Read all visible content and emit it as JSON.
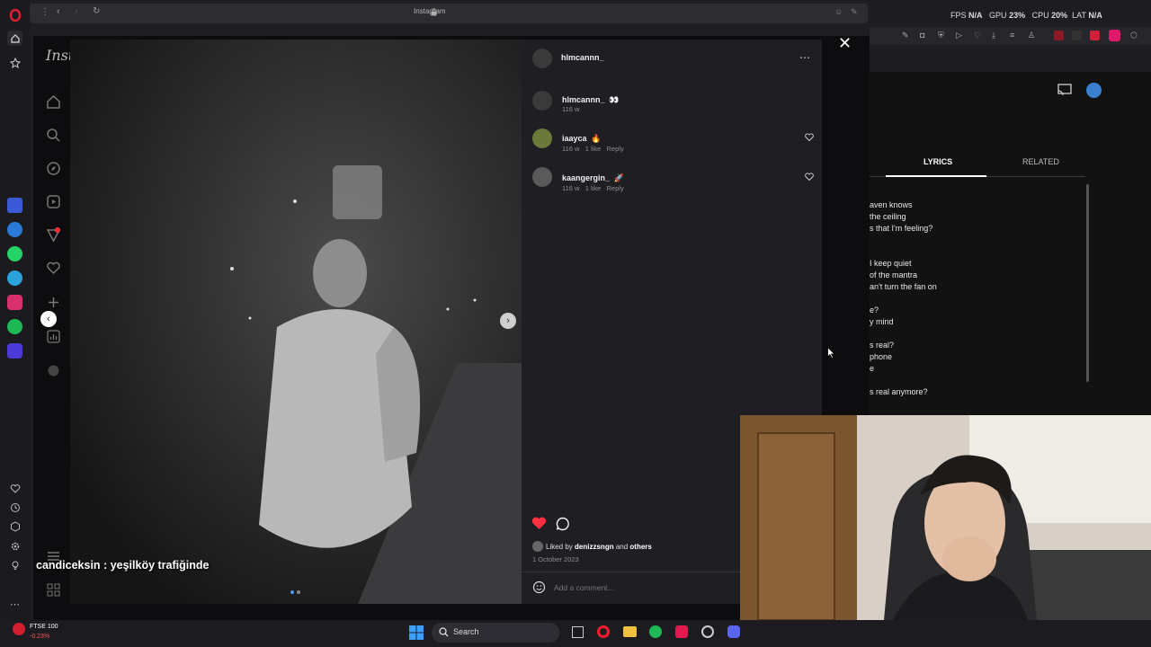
{
  "browser": {
    "url": "Instagram"
  },
  "overlay": {
    "fps_label": "FPS",
    "fps_value": "N/A",
    "gpu_label": "GPU",
    "gpu_value": "23%",
    "cpu_label": "CPU",
    "cpu_value": "20%",
    "lat_label": "LAT",
    "lat_value": "N/A"
  },
  "instagram": {
    "logo": "Inst",
    "post": {
      "author": "hlmcannn_",
      "caption_author": "hlmcannn_",
      "caption_emoji": "👀",
      "caption_time": "116 w",
      "comments": [
        {
          "user": "iaayca",
          "emoji": "🔥",
          "time": "116 w",
          "likes": "1 like",
          "reply": "Reply"
        },
        {
          "user": "kaangergin_",
          "emoji": "🚀",
          "time": "116 w",
          "likes": "1 like",
          "reply": "Reply"
        }
      ],
      "liked_by_prefix": "Liked by",
      "liked_by_user": "denizzsngn",
      "liked_by_and": "and",
      "liked_by_others": "others",
      "date": "1 October 2023",
      "comment_placeholder": "Add a comment...",
      "liked": true
    }
  },
  "chat_overlay": {
    "user": "candiceksin",
    "message": ": yeşilköy trafiğinde"
  },
  "spotify": {
    "tabs": [
      "LYRICS",
      "RELATED"
    ],
    "active_tab": "LYRICS",
    "lyrics": [
      "aven knows",
      "the ceiling",
      "s that I'm feeling?",
      "",
      "I keep quiet",
      "of the mantra",
      "an't turn the fan on",
      "",
      "e?",
      "y mind",
      "",
      "s real?",
      "phone",
      "e",
      "",
      "s real anymore?"
    ]
  },
  "taskbar": {
    "ticker_name": "FTSE 100",
    "ticker_change": "-0.23%",
    "search_label": "Search"
  },
  "colors": {
    "accent_like": "#ff3040",
    "opera_red": "#ff1b2d"
  }
}
